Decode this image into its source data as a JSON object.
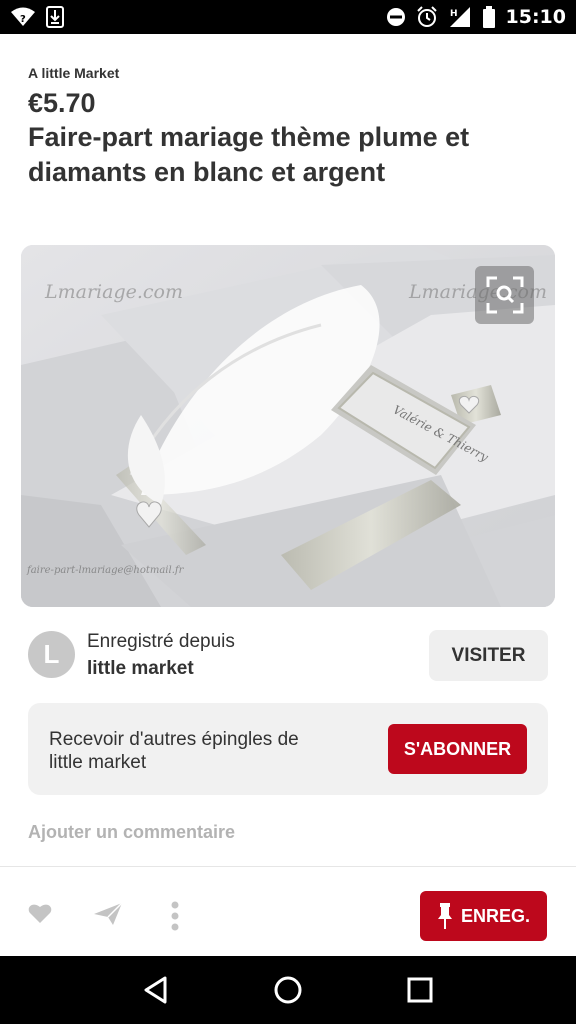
{
  "status_bar": {
    "time": "15:10",
    "network_type": "H",
    "icons": [
      "wifi-icon",
      "download-icon",
      "do-not-disturb-icon",
      "alarm-icon",
      "signal-icon",
      "battery-icon"
    ]
  },
  "pin": {
    "brand": "A little Market",
    "price": "€5.70",
    "title": "Faire-part mariage thème plume et diamants en blanc et argent",
    "image": {
      "watermark_left": "Lmariage.com",
      "watermark_right": "Lmariage.com",
      "watermark_bottom": "faire-part-lmariage@hotmail.fr",
      "card_names": "Valérie & Thierry"
    },
    "saved_from": {
      "avatar_letter": "L",
      "label": "Enregistré depuis",
      "source": "little market",
      "visit_label": "VISITER"
    },
    "follow": {
      "text": "Recevoir d'autres épingles de little market",
      "button_label": "S'ABONNER"
    },
    "comment_placeholder": "Ajouter un commentaire"
  },
  "action_bar": {
    "icons": [
      "heart-icon",
      "send-icon",
      "more-icon"
    ],
    "save_label": "ENREG."
  },
  "nav_bar": {
    "icons": [
      "back-icon",
      "home-icon",
      "recents-icon"
    ]
  },
  "colors": {
    "accent": "#bd081c",
    "text": "#333333",
    "muted": "#b3b3b3",
    "button_bg": "#efefef",
    "panel_bg": "#f1f1f1"
  }
}
